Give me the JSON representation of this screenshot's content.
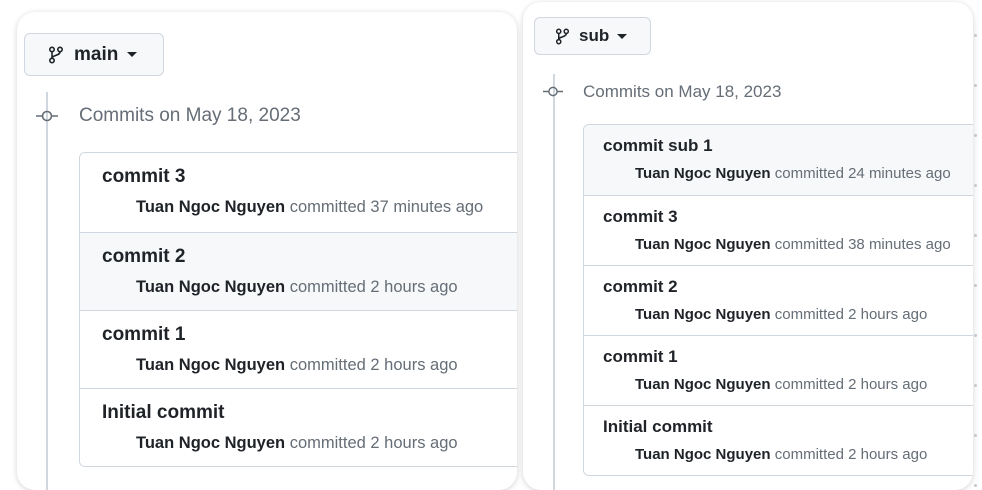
{
  "panels": [
    {
      "branch": {
        "label": "main",
        "icon": "git-branch-icon"
      },
      "date_heading": "Commits on May 18, 2023",
      "commits": [
        {
          "title": "commit 3",
          "author": "Tuan Ngoc Nguyen",
          "meta": "committed 37 minutes ago",
          "highlighted": false
        },
        {
          "title": "commit 2",
          "author": "Tuan Ngoc Nguyen",
          "meta": "committed 2 hours ago",
          "highlighted": true
        },
        {
          "title": "commit 1",
          "author": "Tuan Ngoc Nguyen",
          "meta": "committed 2 hours ago",
          "highlighted": false
        },
        {
          "title": "Initial commit",
          "author": "Tuan Ngoc Nguyen",
          "meta": "committed 2 hours ago",
          "highlighted": false
        }
      ]
    },
    {
      "branch": {
        "label": "sub",
        "icon": "git-branch-icon"
      },
      "date_heading": "Commits on May 18, 2023",
      "commits": [
        {
          "title": "commit sub 1",
          "author": "Tuan Ngoc Nguyen",
          "meta": "committed 24 minutes ago",
          "highlighted": true
        },
        {
          "title": "commit 3",
          "author": "Tuan Ngoc Nguyen",
          "meta": "committed 38 minutes ago",
          "highlighted": false
        },
        {
          "title": "commit 2",
          "author": "Tuan Ngoc Nguyen",
          "meta": "committed 2 hours ago",
          "highlighted": false
        },
        {
          "title": "commit 1",
          "author": "Tuan Ngoc Nguyen",
          "meta": "committed 2 hours ago",
          "highlighted": false
        },
        {
          "title": "Initial commit",
          "author": "Tuan Ngoc Nguyen",
          "meta": "committed 2 hours ago",
          "highlighted": false
        }
      ]
    }
  ],
  "colors": {
    "text_primary": "#1f2328",
    "text_muted": "#656d76",
    "border": "#d0d7de",
    "highlight_row": "#f6f8fa"
  }
}
